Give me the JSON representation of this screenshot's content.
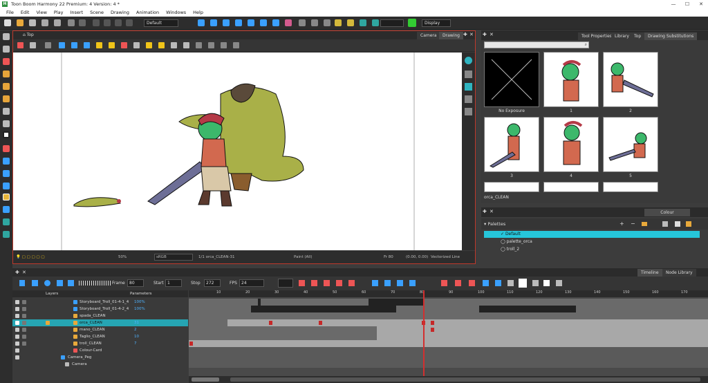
{
  "window": {
    "title": "Toon Boom Harmony 22 Premium: 4 Version: 4 *",
    "minimize": "—",
    "maximize": "☐",
    "close": "✕"
  },
  "menu": [
    "File",
    "Edit",
    "View",
    "Play",
    "Insert",
    "Scene",
    "Drawing",
    "Animation",
    "Windows",
    "Help"
  ],
  "toolbar": {
    "workspace": "Default",
    "display": "Display"
  },
  "camera_view": {
    "breadcrumb": "Top",
    "tabs": [
      "Camera",
      "Drawing"
    ],
    "status": {
      "zoom": "50%",
      "colorspace": "sRGB",
      "drawing": "1/1   orca_CLEAN-31",
      "mode": "Paint (All)",
      "frame": "Fr 80",
      "coords": "(0.00, 0.00)",
      "vector": "Vectorized Line"
    }
  },
  "right_panel": {
    "tabs": [
      "Tool Properties",
      "Library",
      "Top",
      "Drawing Substitutions"
    ],
    "thumbnails": [
      "No Exposure",
      "1",
      "2",
      "3",
      "4",
      "5"
    ],
    "current_drawing": "orca_CLEAN"
  },
  "colour_panel": {
    "tab": "Colour",
    "palettes_label": "Palettes",
    "palettes": [
      {
        "name": "Default",
        "selected": true
      },
      {
        "name": "palette_orca",
        "selected": false
      },
      {
        "name": "troll_2",
        "selected": false
      }
    ]
  },
  "timeline": {
    "tabs": [
      "Timeline",
      "Node Library"
    ],
    "frame_label": "Frame",
    "frame_value": "80",
    "start_label": "Start",
    "start_value": "1",
    "stop_label": "Stop",
    "stop_value": "272",
    "fps_label": "FPS",
    "fps_value": "24",
    "layers_header": "Layers",
    "params_header": "Parameters",
    "layers": [
      {
        "name": "Storyboard_Troll_01-4-1_4",
        "param": "100%"
      },
      {
        "name": "Storyboard_Troll_01-4-2_4",
        "param": "100%"
      },
      {
        "name": "spada_CLEAN",
        "param": ""
      },
      {
        "name": "orca_CLEAN",
        "param": "31"
      },
      {
        "name": "mano_CLEAN",
        "param": "2"
      },
      {
        "name": "Taglio_CLEAN",
        "param": "10"
      },
      {
        "name": "troll_CLEAN",
        "param": "7"
      },
      {
        "name": "Colour-Card",
        "param": ""
      },
      {
        "name": "Camera_Peg",
        "param": ""
      },
      {
        "name": "Camera",
        "param": ""
      }
    ],
    "ruler": [
      "10",
      "20",
      "30",
      "40",
      "50",
      "60",
      "70",
      "80",
      "90",
      "100",
      "110",
      "120",
      "130",
      "140",
      "150",
      "160",
      "170"
    ]
  },
  "colors": {
    "accent": "#26c6da",
    "selection_red": "#c0392b",
    "playhead": "#d32f2f"
  }
}
